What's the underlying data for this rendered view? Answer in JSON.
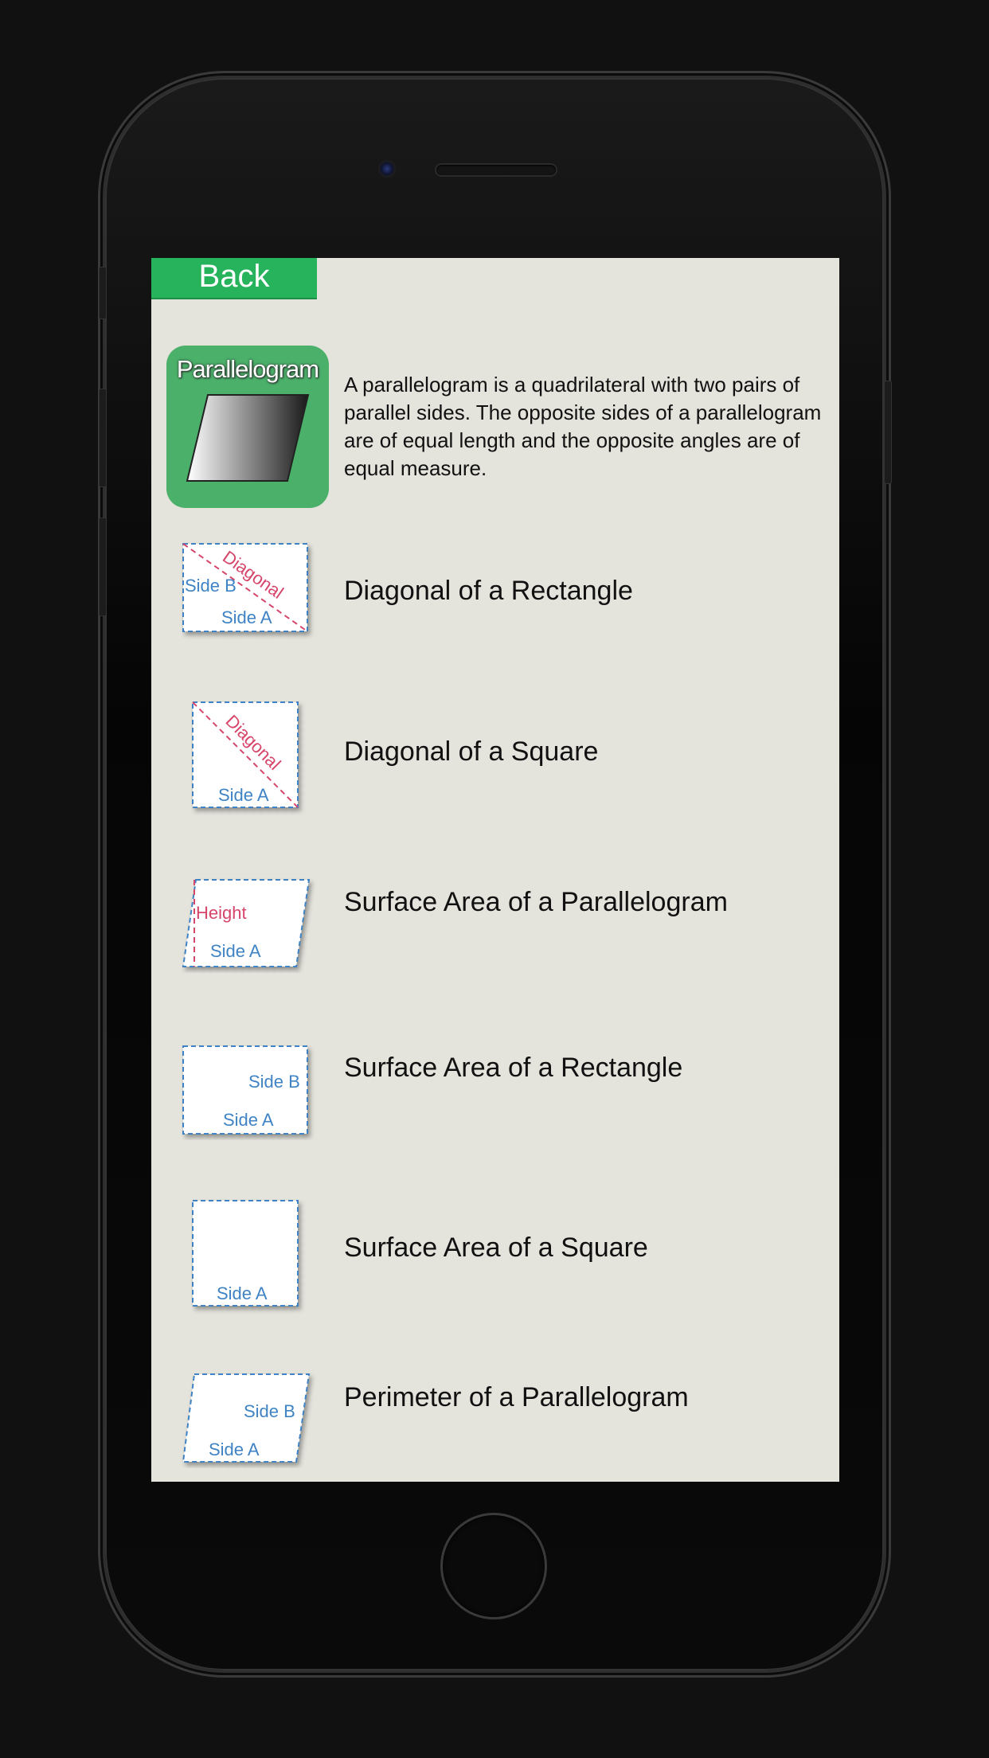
{
  "back_label": "Back",
  "hero": {
    "icon_label": "Parallelogram",
    "description": "A parallelogram is a quadrilateral with two pairs of parallel sides. The opposite sides of a parallelogram are of equal length and the opposite angles are of equal measure."
  },
  "items": [
    {
      "label": "Diagonal of a Rectangle",
      "thumb_labels": [
        "Side B",
        "Side A",
        "Diagonal"
      ]
    },
    {
      "label": "Diagonal of a Square",
      "thumb_labels": [
        "Side A",
        "Diagonal"
      ]
    },
    {
      "label": "Surface Area of a Parallelogram",
      "thumb_labels": [
        "Height",
        "Side A"
      ]
    },
    {
      "label": "Surface Area of a Rectangle",
      "thumb_labels": [
        "Side B",
        "Side A"
      ]
    },
    {
      "label": "Surface Area of a Square",
      "thumb_labels": [
        "Side A"
      ]
    },
    {
      "label": "Perimeter of a Parallelogram",
      "thumb_labels": [
        "Side B",
        "Side A"
      ]
    }
  ],
  "colors": {
    "back_button": "#27b35c",
    "icon_background": "#4bb06a",
    "screen_background": "#e4e3dc",
    "side_label": "#3f83c4",
    "diagonal_label": "#d6456a"
  }
}
